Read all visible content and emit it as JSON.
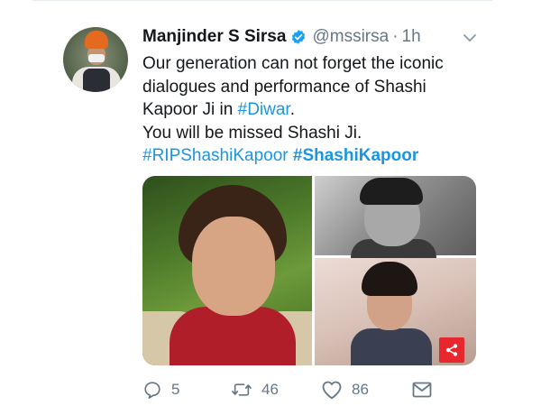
{
  "tweet": {
    "author_name": "Manjinder S Sirsa",
    "handle": "@mssirsa",
    "separator": "·",
    "time": "1h",
    "text": {
      "line1": "Our generation can not forget the iconic",
      "line2": "dialogues and performance of Shashi",
      "line3_prefix": "Kapoor Ji in ",
      "line3_hashtag": "#Diwar",
      "line3_suffix": ".",
      "line4": "You will be missed Shashi Ji.",
      "hashtag1": "#RIPShashiKapoor",
      "hashtag2": "#ShashiKapoor"
    }
  },
  "actions": {
    "reply_count": "5",
    "retweet_count": "46",
    "like_count": "86"
  },
  "colors": {
    "link": "#1b95e0",
    "muted": "#657786",
    "verified": "#1da1f2",
    "share_badge": "#e8262d"
  },
  "icons": {
    "verified": "verified-badge-icon",
    "menu": "chevron-down-icon",
    "reply": "reply-icon",
    "retweet": "retweet-icon",
    "like": "heart-icon",
    "dm": "envelope-icon",
    "share": "share-icon"
  }
}
